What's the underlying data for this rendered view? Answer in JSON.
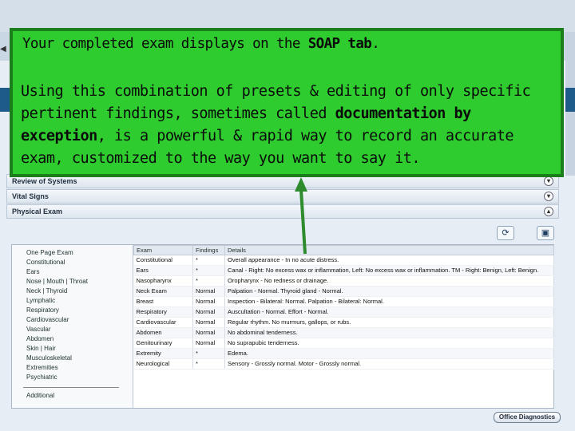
{
  "callout": {
    "line1_prefix": "Your completed exam displays on the ",
    "line1_bold": "SOAP tab",
    "line1_suffix": ".",
    "para_prefix": "Using this combination of presets & editing of only specific pertinent findings, sometimes called ",
    "para_bold": "documentation by exception",
    "para_suffix": ", is a powerful & rapid way to record an accurate exam, customized to the way you want to say it.",
    "color": "#2ecc2e",
    "arrow_color": "#2e8b2e"
  },
  "sections": {
    "review_of_systems": "Review of Systems",
    "vital_signs": "Vital Signs",
    "physical_exam": "Physical Exam"
  },
  "exam_list": {
    "items": [
      "One Page Exam",
      "Constitutional",
      "Ears",
      "Nose | Mouth | Throat",
      "Neck | Thyroid",
      "Lymphatic",
      "Respiratory",
      "Cardiovascular",
      "Vascular",
      "Abdomen",
      "Skin | Hair",
      "Musculoskeletal",
      "Extremities",
      "Psychiatric"
    ],
    "additional": "Additional"
  },
  "table": {
    "headers": [
      "Exam",
      "Findings",
      "Details"
    ],
    "rows": [
      {
        "exam": "Constitutional",
        "findings": "*",
        "details": "Overall appearance - In no acute distress."
      },
      {
        "exam": "Ears",
        "findings": "*",
        "details": "Canal - Right: No excess wax or inflammation, Left: No excess wax or inflammation. TM - Right: Benign, Left: Benign."
      },
      {
        "exam": "Nasopharynx",
        "findings": "*",
        "details": "Oropharynx - No redness or drainage."
      },
      {
        "exam": "Neck Exam",
        "findings": "Normal",
        "details": "Palpation - Normal. Thyroid gland - Normal."
      },
      {
        "exam": "Breast",
        "findings": "Normal",
        "details": "Inspection - Bilateral: Normal. Palpation - Bilateral: Normal."
      },
      {
        "exam": "Respiratory",
        "findings": "Normal",
        "details": "Auscultation - Normal. Effort - Normal."
      },
      {
        "exam": "Cardiovascular",
        "findings": "Normal",
        "details": "Regular rhythm. No murmurs, gallops, or rubs."
      },
      {
        "exam": "Abdomen",
        "findings": "Normal",
        "details": "No abdominal tenderness."
      },
      {
        "exam": "Genitourinary",
        "findings": "Normal",
        "details": "No suprapubic tenderness."
      },
      {
        "exam": "Extremity",
        "findings": "*",
        "details": "Edema."
      },
      {
        "exam": "Neurological",
        "findings": "*",
        "details": "Sensory - Grossly normal. Motor - Grossly normal."
      }
    ]
  },
  "buttons": {
    "office_diagnostics": "Office Diagnostics",
    "refresh_icon": "refresh-icon",
    "save_icon": "save-icon"
  }
}
